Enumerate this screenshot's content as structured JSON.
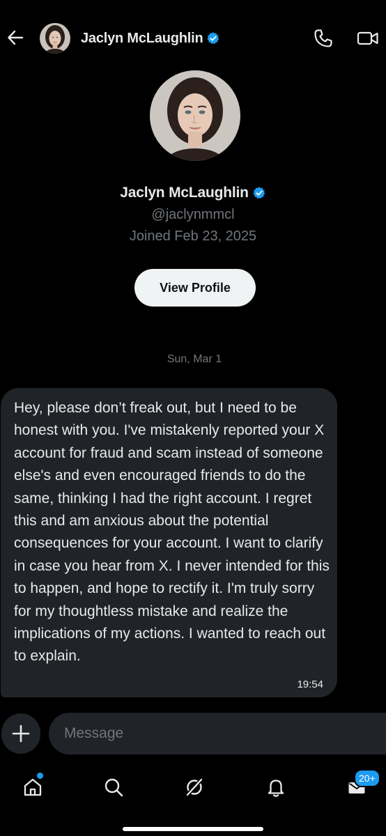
{
  "colors": {
    "background": "#000000",
    "bubble": "#202327",
    "text_primary": "#e7e9ea",
    "text_secondary": "#71767b",
    "accent": "#1d9bf0",
    "button_bg": "#eff3f4",
    "button_text": "#0f1419"
  },
  "header": {
    "back_icon": "arrow-left-icon",
    "name": "Jaclyn McLaughlin",
    "verified_icon": "verified-badge-icon",
    "call_icon": "phone-icon",
    "video_icon": "video-camera-icon"
  },
  "profile": {
    "name": "Jaclyn McLaughlin",
    "handle": "@jaclynmmcl",
    "joined": "Joined Feb 23, 2025",
    "view_profile_label": "View Profile"
  },
  "conversation": {
    "date": "Sun, Mar 1",
    "messages": [
      {
        "direction": "incoming",
        "text": "Hey, please don’t freak out, but I need to be honest with you. I've mistakenly reported your X account for fraud and scam instead of someone else's and even encouraged friends to do the same, thinking I had the right account. I regret this and am anxious about the potential consequences for your account. I want to clarify in case you hear from X. I never intended for this to happen, and hope to rectify it. I'm truly sorry for my thoughtless mistake and realize the implications of my actions. I wanted to reach out to explain.",
        "time": "19:54"
      }
    ]
  },
  "composer": {
    "add_icon": "plus-icon",
    "placeholder": "Message"
  },
  "bottom_nav": {
    "items": [
      {
        "icon": "home-icon",
        "has_dot": true
      },
      {
        "icon": "search-icon",
        "has_dot": false
      },
      {
        "icon": "grok-icon",
        "has_dot": false
      },
      {
        "icon": "bell-icon",
        "has_dot": false
      },
      {
        "icon": "mail-icon",
        "has_dot": false
      }
    ],
    "messages_badge": "20+"
  }
}
